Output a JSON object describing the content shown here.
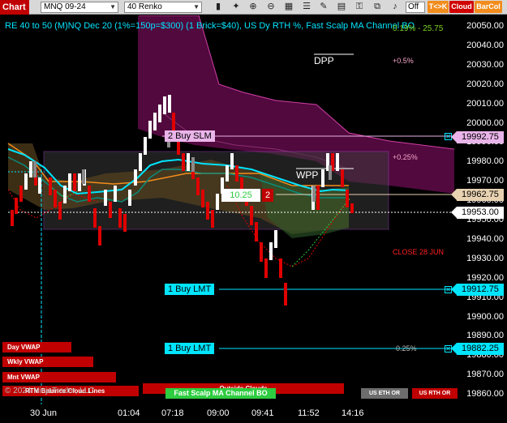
{
  "toolbar": {
    "chart_label": "Chart",
    "instrument": "MNQ 09-24",
    "bar_type": "40 Renko",
    "off_label": "Off",
    "tk_label": "T<>K",
    "cloud_label": "Cloud",
    "barcol_label": "BarCol",
    "icons": [
      "bar-chart-icon",
      "tools-icon",
      "zoom-in-icon",
      "zoom-out-icon",
      "layout-icon",
      "properties-icon",
      "pencil-icon",
      "grid-icon",
      "lock-icon",
      "layers-icon",
      "bell-icon",
      "dots-icon"
    ]
  },
  "header": {
    "title": "RE 40 to 50 (M)NQ Dec 20 (1%=150p=$300) (1 Brick=$40), US Dy RTH %, Fast Scalp MA Channel BO",
    "pct": "0.19% - 25.75"
  },
  "price_axis": [
    "20050.00",
    "20040.00",
    "20030.00",
    "20020.00",
    "20010.00",
    "20000.00",
    "19990.00",
    "19980.00",
    "19970.00",
    "19960.00",
    "19950.00",
    "19940.00",
    "19930.00",
    "19920.00",
    "19910.00",
    "19900.00",
    "19890.00",
    "19880.00",
    "19870.00",
    "19860.00"
  ],
  "time_axis": [
    "30 Jun",
    "01:04",
    "07:18",
    "09:00",
    "09:41",
    "11:52",
    "14:16"
  ],
  "price_tags": {
    "buy_slm_price": "19992.75",
    "mid_price": "19962.75",
    "last_price": "19953.00",
    "buy_lmt_price": "19912.75",
    "buy_lmt2_price": "19882.25"
  },
  "orders": {
    "buy_slm": "2 Buy SLM",
    "buy_lmt": "1 Buy LMT",
    "buy_lmt2": "1 Buy LMT"
  },
  "position": {
    "pnl": "10.25",
    "qty": "2"
  },
  "annotations": {
    "dpp": "DPP",
    "wpp": "WPP",
    "pct_05": "+0.5%",
    "pct_025": "+0.25%",
    "close": "CLOSE 28 JUN",
    "neg_025": "0.25%"
  },
  "bottom": {
    "day_vwap": "Day VWAP",
    "wkly_vwap": "Wkly VWAP",
    "mnt_vwap": "Mnt VWAP",
    "rtm": "RTM Balance Cloud Lines",
    "outside": "Outside Clouds",
    "fast_scalp": "Fast Scalp MA Channel BO",
    "us_eth": "US ETH OR",
    "us_rth": "US RTH OR",
    "copyright": "© 2024 NinjaTrader, LLC"
  },
  "colors": {
    "up": "#ffffff",
    "down": "#e00000",
    "cyan": "#00e5ff",
    "orange": "#f28c1c",
    "magenta_cloud": "#5a0a45",
    "green": "#2ecc40"
  }
}
